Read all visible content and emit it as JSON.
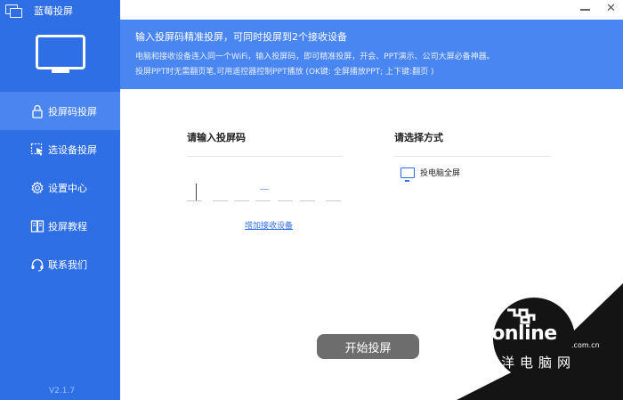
{
  "window": {
    "title": "蓝莓投屏",
    "minimize_label": "",
    "close_label": "✕"
  },
  "sidebar": {
    "items": [
      {
        "label": "投屏码投屏",
        "active": true,
        "icon": "lock-icon"
      },
      {
        "label": "选设备投屏",
        "active": false,
        "icon": "cursor-select-icon"
      },
      {
        "label": "设置中心",
        "active": false,
        "icon": "gear-icon"
      },
      {
        "label": "投屏教程",
        "active": false,
        "icon": "book-icon"
      },
      {
        "label": "联系我们",
        "active": false,
        "icon": "headset-icon"
      }
    ],
    "version": "V2.1.7"
  },
  "header": {
    "line1": "输入投屏码精准投屏，可同时投屏到2个接收设备",
    "line2": "电脑和接收设备连入同一个WiFi，输入投屏码，即可精准投屏，开会、PPT演示、公司大屏必备神器。",
    "line3": "投屏PPT时无需翻页笔,可用遥控器控制PPT播放 (OK键: 全屏播放PPT; 上下键:翻页 )"
  },
  "code_section": {
    "title": "请输入投屏码",
    "add_device_link": "增加接收设备"
  },
  "mode_section": {
    "title": "请选择方式",
    "option_label": "投电脑全屏",
    "option_icon": "monitor-icon"
  },
  "start_button": {
    "label": "开始投屏"
  },
  "watermark": {
    "brand": "PConline",
    "domain": ".com.cn",
    "cn": "太平洋电脑网"
  },
  "colors": {
    "sidebar": "#2f6fe5",
    "header": "#4a86f1",
    "active_item": "#4a85f0",
    "button": "#6d6d6d"
  }
}
